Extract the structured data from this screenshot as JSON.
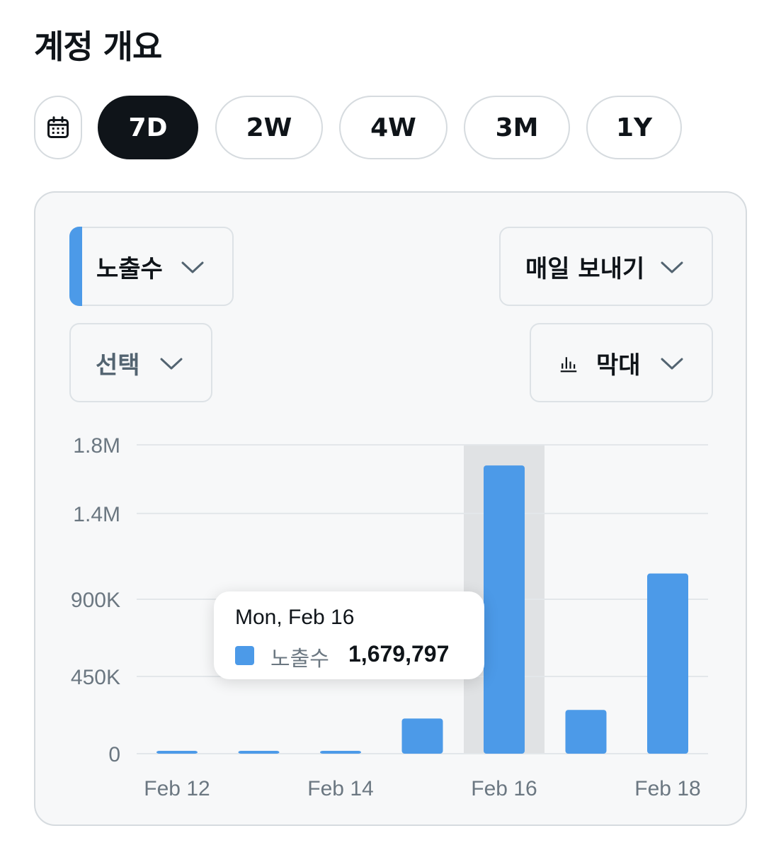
{
  "header": {
    "title": "계정 개요"
  },
  "range_selector": {
    "calendar_icon": "calendar-icon",
    "options": [
      {
        "label": "7D",
        "active": true
      },
      {
        "label": "2W",
        "active": false
      },
      {
        "label": "4W",
        "active": false
      },
      {
        "label": "3M",
        "active": false
      },
      {
        "label": "1Y",
        "active": false
      }
    ]
  },
  "controls": {
    "metric": {
      "label": "노출수",
      "icon": "chevron-down-icon",
      "accent_color": "#4c9ae8"
    },
    "compare": {
      "label": "선택",
      "icon": "chevron-down-icon"
    },
    "frequency": {
      "label": "매일 보내기",
      "icon": "chevron-down-icon"
    },
    "chart_type": {
      "label": "막대",
      "icon": "bar-chart-icon"
    }
  },
  "tooltip": {
    "date": "Mon, Feb 16",
    "series": "노출수",
    "value": "1,679,797",
    "swatch_color": "#4c9ae8"
  },
  "chart_data": {
    "type": "bar",
    "categories": [
      "Feb 12",
      "Feb 13",
      "Feb 14",
      "Feb 15",
      "Feb 16",
      "Feb 17",
      "Feb 18"
    ],
    "x_tick_labels": [
      "Feb 12",
      "",
      "Feb 14",
      "",
      "Feb 16",
      "",
      "Feb 18"
    ],
    "series": [
      {
        "name": "노출수",
        "color": "#4c9ae8",
        "values": [
          9000,
          9000,
          15000,
          205000,
          1679797,
          255000,
          1050000
        ]
      }
    ],
    "ylim": [
      0,
      1800000
    ],
    "y_ticks": [
      0,
      450000,
      900000,
      1400000,
      1800000
    ],
    "y_tick_labels": [
      "0",
      "450K",
      "900K",
      "1.4M",
      "1.8M"
    ],
    "highlight_category": "Feb 16",
    "grid": true
  }
}
